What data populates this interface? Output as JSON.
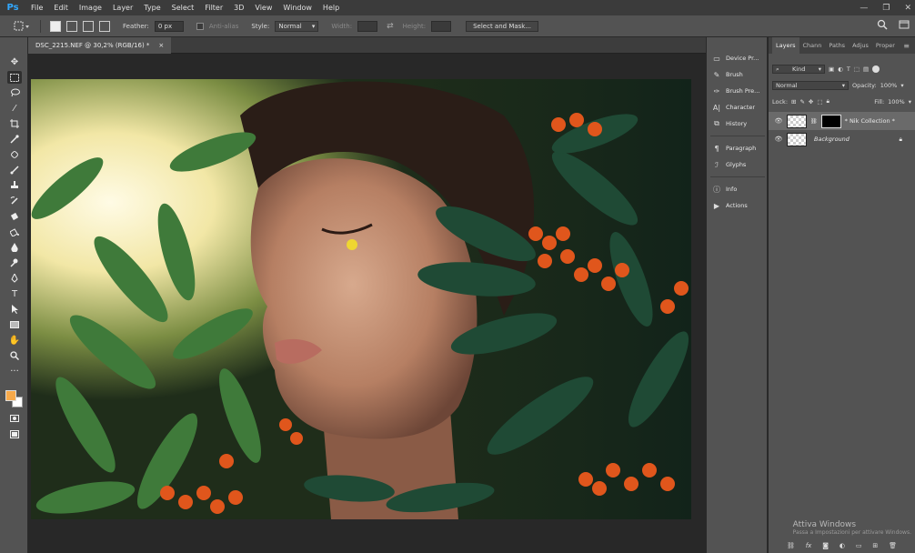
{
  "menubar": {
    "logo": "Ps",
    "items": [
      "File",
      "Edit",
      "Image",
      "Layer",
      "Type",
      "Select",
      "Filter",
      "3D",
      "View",
      "Window",
      "Help"
    ],
    "window_controls": {
      "minimize": "—",
      "maximize": "❐",
      "close": "✕"
    }
  },
  "optionsbar": {
    "feather_label": "Feather:",
    "feather_value": "0 px",
    "antialias_label": "Anti-alias",
    "style_label": "Style:",
    "style_value": "Normal",
    "width_label": "Width:",
    "height_label": "Height:",
    "select_mask_label": "Select and Mask..."
  },
  "document": {
    "tab_title": "DSC_2215.NEF @ 30,2% (RGB/16) *",
    "close_icon": "×"
  },
  "colors": {
    "foreground": "#f7a94a",
    "background": "#ffffff"
  },
  "dock": {
    "items": [
      {
        "label": "Device Pr...",
        "icon": "device-preview-icon"
      },
      {
        "label": "Brush",
        "icon": "brush-icon"
      },
      {
        "label": "Brush Pre...",
        "icon": "brush-presets-icon"
      },
      {
        "label": "Character",
        "icon": "character-icon"
      },
      {
        "label": "History",
        "icon": "history-icon"
      },
      {
        "label": "Paragraph",
        "icon": "paragraph-icon"
      },
      {
        "label": "Glyphs",
        "icon": "glyphs-icon"
      },
      {
        "label": "Info",
        "icon": "info-icon"
      },
      {
        "label": "Actions",
        "icon": "actions-icon"
      }
    ]
  },
  "layers_panel": {
    "tabs": [
      "Layers",
      "Chann",
      "Paths",
      "Adjus",
      "Proper"
    ],
    "filter_label": "Kind",
    "blend_mode": "Normal",
    "opacity_label": "Opacity:",
    "opacity_value": "100%",
    "lock_label": "Lock:",
    "fill_label": "Fill:",
    "fill_value": "100%",
    "layers": [
      {
        "name": "* Nik Collection *",
        "selected": true
      },
      {
        "name": "Background",
        "selected": false
      }
    ]
  },
  "watermark": {
    "title": "Attiva Windows",
    "subtitle": "Passa a Impostazioni per attivare Windows."
  }
}
